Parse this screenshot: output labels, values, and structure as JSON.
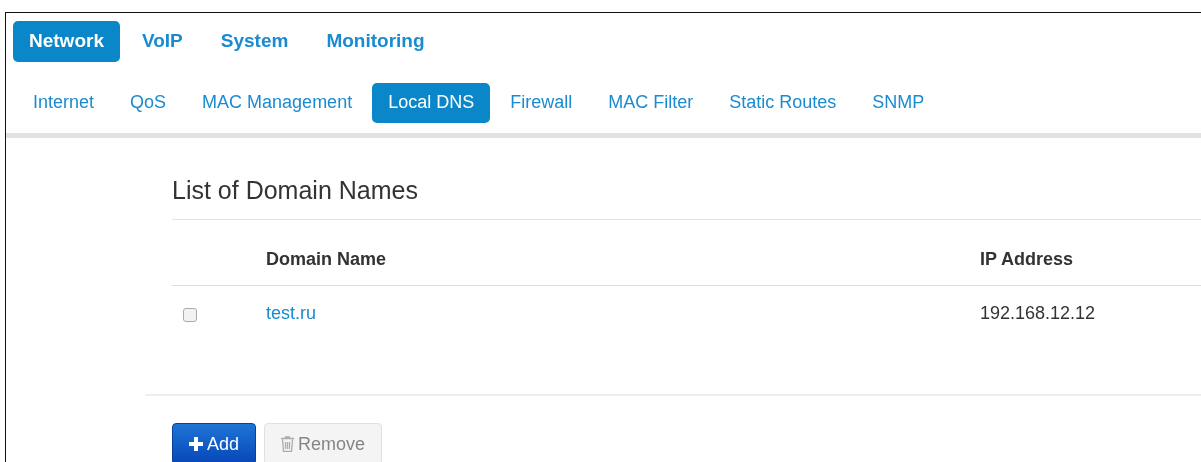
{
  "main_tabs": [
    {
      "label": "Network",
      "selected": true
    },
    {
      "label": "VoIP",
      "selected": false
    },
    {
      "label": "System",
      "selected": false
    },
    {
      "label": "Monitoring",
      "selected": false
    }
  ],
  "sub_tabs": [
    {
      "label": "Internet",
      "selected": false
    },
    {
      "label": "QoS",
      "selected": false
    },
    {
      "label": "MAC Management",
      "selected": false
    },
    {
      "label": "Local DNS",
      "selected": true
    },
    {
      "label": "Firewall",
      "selected": false
    },
    {
      "label": "MAC Filter",
      "selected": false
    },
    {
      "label": "Static Routes",
      "selected": false
    },
    {
      "label": "SNMP",
      "selected": false
    }
  ],
  "section_title": "List of Domain Names",
  "table": {
    "columns": [
      "Domain Name",
      "IP Address"
    ],
    "rows": [
      {
        "checked": false,
        "domain": "test.ru",
        "ip": "192.168.12.12"
      }
    ]
  },
  "buttons": [
    {
      "kind": "add",
      "label": "Add",
      "disabled": false
    },
    {
      "kind": "remove",
      "label": "Remove",
      "disabled": true
    }
  ]
}
